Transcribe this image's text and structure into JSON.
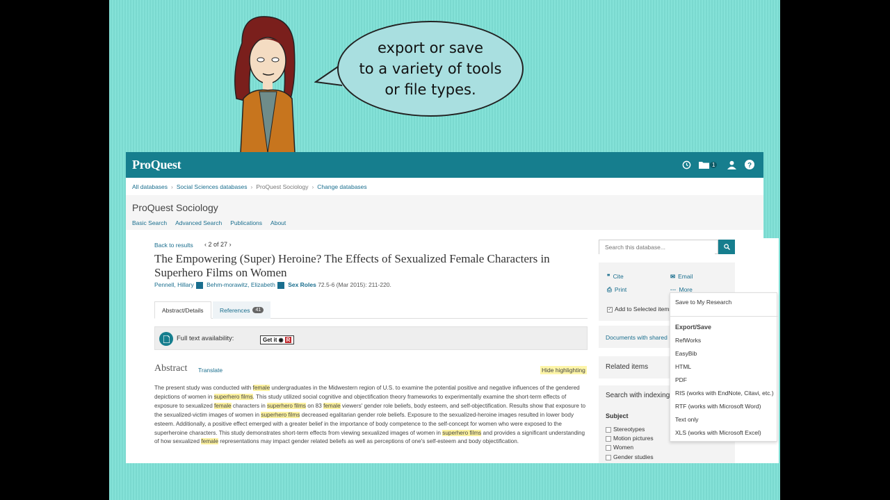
{
  "bubble": {
    "text": "export or save\nto a variety of tools\nor file types."
  },
  "app": {
    "logo": "ProQuest",
    "folder_count": "1",
    "breadcrumbs": [
      "All databases",
      "Social Sciences databases",
      "ProQuest Sociology",
      "Change databases"
    ],
    "db_title": "ProQuest Sociology",
    "subnav": [
      "Basic Search",
      "Advanced Search",
      "Publications",
      "About"
    ]
  },
  "article": {
    "back": "Back to results",
    "pager": "2 of 27",
    "title": "The Empowering (Super) Heroine? The Effects of Sexualized Female Characters in Superhero Films on Women",
    "author1": "Pennell, Hillary",
    "author2": "Behm-morawitz, Elizabeth",
    "journal": "Sex Roles",
    "citation": "72.5-6  (Mar 2015): 211-220.",
    "tab_abstract": "Abstract/Details",
    "tab_references": "References",
    "references_count": "41",
    "fulltext_label": "Full text availability:",
    "getit": "Get it",
    "abstract_heading": "Abstract",
    "translate": "Translate",
    "hide_highlighting": "Hide highlighting",
    "abstract_segments": [
      {
        "t": "The present study was conducted with ",
        "h": false
      },
      {
        "t": "female",
        "h": true
      },
      {
        "t": " undergraduates in the Midwestern region of U.S. to examine the potential positive and negative influences of the gendered depictions of women in ",
        "h": false
      },
      {
        "t": "superhero films",
        "h": true
      },
      {
        "t": ". This study utilized social cognitive and objectification theory frameworks to experimentally examine the short-term effects of exposure to sexualized ",
        "h": false
      },
      {
        "t": "female",
        "h": true
      },
      {
        "t": " characters in ",
        "h": false
      },
      {
        "t": "superhero films",
        "h": true
      },
      {
        "t": " on 83 ",
        "h": false
      },
      {
        "t": "female",
        "h": true
      },
      {
        "t": " viewers' gender role beliefs, body esteem, and self-objectification. Results show that exposure to the sexualized-victim images of women in ",
        "h": false
      },
      {
        "t": "superhero films",
        "h": true
      },
      {
        "t": " decreased egalitarian gender role beliefs. Exposure to the sexualized-heroine images resulted in lower body esteem. Additionally, a positive effect emerged with a greater belief in the importance of body competence to the self-concept for women who were exposed to the superheroine characters. This study demonstrates short-term effects from viewing sexualized images of women in ",
        "h": false
      },
      {
        "t": "superhero films",
        "h": true
      },
      {
        "t": " and provides a significant understanding of how sexualized ",
        "h": false
      },
      {
        "t": "female",
        "h": true
      },
      {
        "t": " representations may impact gender related beliefs as well as perceptions of one's self-esteem and body objectification.",
        "h": false
      }
    ]
  },
  "sidebar": {
    "search_placeholder": "Search this database...",
    "cite": "Cite",
    "email": "Email",
    "print": "Print",
    "more": "More",
    "add_selected": "Add to Selected items",
    "docs_shared": "Documents with shared",
    "related": "Related items",
    "search_indexing": "Search with indexing",
    "subject_heading": "Subject",
    "subjects": [
      "Stereotypes",
      "Motion pictures",
      "Women",
      "Gender studies"
    ]
  },
  "dropdown": {
    "save_research": "Save to My Research",
    "export_heading": "Export/Save",
    "items": [
      "RefWorks",
      "EasyBib",
      "HTML",
      "PDF",
      "RIS (works with EndNote, Citavi, etc.)",
      "RTF (works with Microsoft Word)",
      "Text only",
      "XLS (works with Microsoft Excel)"
    ]
  }
}
